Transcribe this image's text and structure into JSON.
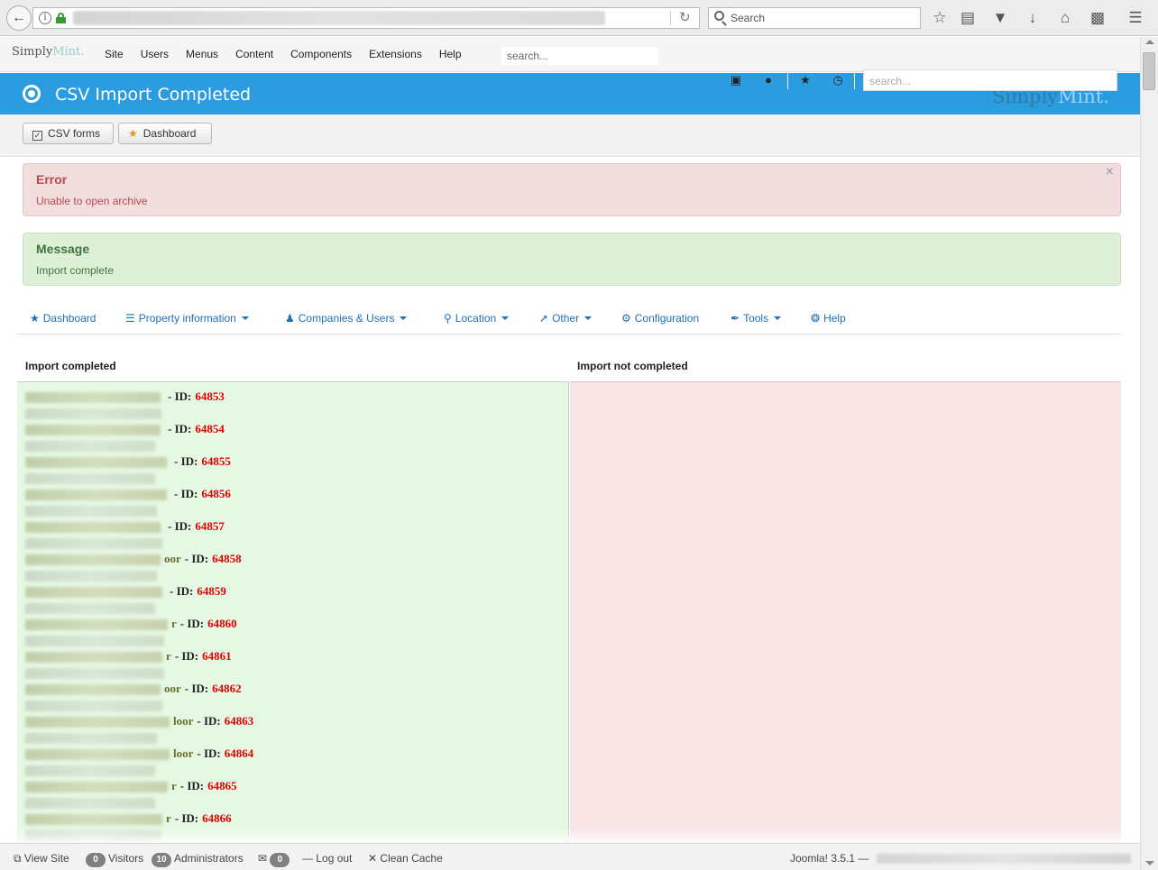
{
  "browser": {
    "search_placeholder": "Search"
  },
  "admin_nav": {
    "brand_part1": "Simply",
    "brand_part2": "Mint.",
    "menu": [
      "Site",
      "Users",
      "Menus",
      "Content",
      "Components",
      "Extensions",
      "Help"
    ],
    "search_placeholder": "search..."
  },
  "header": {
    "title": "CSV Import Completed",
    "search_placeholder": "search...",
    "brand_part1": "Simply",
    "brand_part2": "Mint.",
    "accent_color": "#2b9cdf"
  },
  "toolbar": {
    "csv_forms_label": "CSV forms",
    "dashboard_label": "Dashboard"
  },
  "alerts": {
    "error_heading": "Error",
    "error_text": "Unable to open archive",
    "message_heading": "Message",
    "message_text": "Import complete",
    "close_glyph": "×"
  },
  "component_menu": {
    "items": [
      {
        "label": "Dashboard",
        "icon": "star-icon"
      },
      {
        "label": "Property information",
        "icon": "list-icon"
      },
      {
        "label": "Companies & Users",
        "icon": "user-icon"
      },
      {
        "label": "Location",
        "icon": "map-marker-icon"
      },
      {
        "label": "Other",
        "icon": "wrench-icon"
      },
      {
        "label": "Configuration",
        "icon": "gear-icon"
      },
      {
        "label": "Tools",
        "icon": "tools-icon"
      },
      {
        "label": "Help",
        "icon": "lifebuoy-icon"
      }
    ]
  },
  "results": {
    "completed_heading": "Import completed",
    "not_completed_heading": "Import not completed",
    "rows": [
      {
        "tail": "",
        "id_label": "- ID:",
        "id": "64853"
      },
      {
        "tail": "",
        "id_label": "- ID:",
        "id": "64854"
      },
      {
        "tail": "",
        "id_label": "- ID:",
        "id": "64855"
      },
      {
        "tail": "",
        "id_label": "- ID:",
        "id": "64856"
      },
      {
        "tail": "",
        "id_label": "- ID:",
        "id": "64857"
      },
      {
        "tail": "oor",
        "id_label": "- ID:",
        "id": "64858"
      },
      {
        "tail": "",
        "id_label": "- ID:",
        "id": "64859"
      },
      {
        "tail": "r",
        "id_label": "- ID:",
        "id": "64860"
      },
      {
        "tail": "r",
        "id_label": "- ID:",
        "id": "64861"
      },
      {
        "tail": "oor",
        "id_label": "- ID:",
        "id": "64862"
      },
      {
        "tail": "loor",
        "id_label": "- ID:",
        "id": "64863"
      },
      {
        "tail": "loor",
        "id_label": "- ID:",
        "id": "64864"
      },
      {
        "tail": "r",
        "id_label": "- ID:",
        "id": "64865"
      },
      {
        "tail": "r",
        "id_label": "- ID:",
        "id": "64866"
      }
    ],
    "ok_color": "#e5f8e3",
    "fail_color": "#f7e4e5",
    "id_color": "#e30000"
  },
  "status_bar": {
    "view_site": "View Site",
    "visitors_count": "0",
    "visitors_label": "Visitors",
    "admins_count": "10",
    "admins_label": "Administrators",
    "messages_count": "0",
    "logout": "Log out",
    "clean_cache": "Clean Cache",
    "version": "Joomla! 3.5.1 —"
  }
}
